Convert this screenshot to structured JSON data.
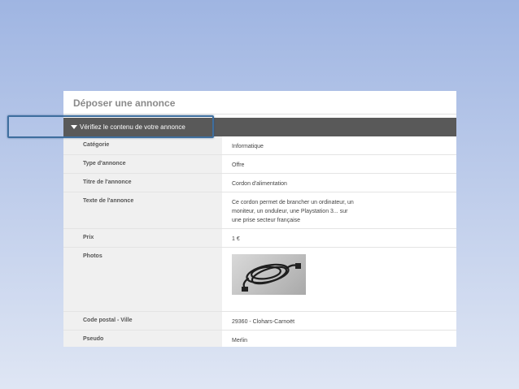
{
  "panel": {
    "title": "Déposer une annonce",
    "section_label": "Vérifiez le contenu de votre annonce"
  },
  "rows": [
    {
      "label": "Catégorie",
      "value": "Informatique"
    },
    {
      "label": "Type d'annonce",
      "value": "Offre"
    },
    {
      "label": "Titre de l'annonce",
      "value": "Cordon d'alimentation"
    },
    {
      "label": "Texte de l'annonce",
      "value_lines": [
        "Ce cordon permet de brancher un ordinateur, un",
        "moniteur, un onduleur, une Playstation 3... sur",
        "une prise secteur française"
      ]
    },
    {
      "label": "Prix",
      "value": "1 €"
    },
    {
      "label": "Photos"
    },
    {
      "label": "Code postal - Ville",
      "value": "29360 - Clohars-Carnoët"
    },
    {
      "label": "Pseudo",
      "value": "Merlin"
    }
  ],
  "icons": {
    "section_toggle": "triangle-down-icon"
  },
  "colors": {
    "section_bar": "#595959",
    "highlight": "#3e6e9e",
    "label_bg": "#f0f0f0"
  }
}
